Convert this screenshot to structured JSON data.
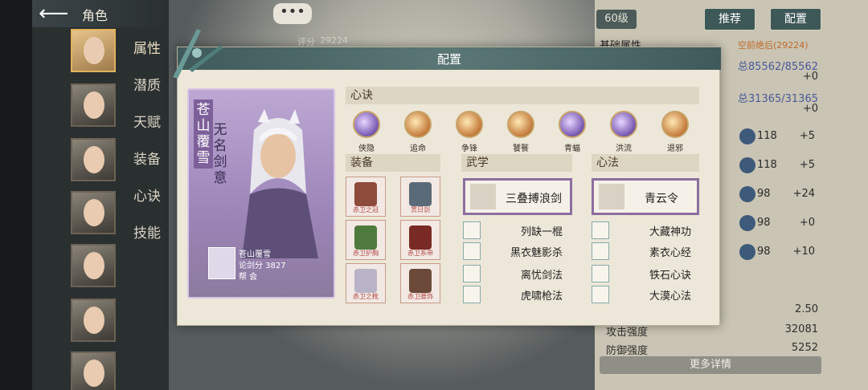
{
  "header": {
    "title": "角色",
    "chat_icon": "•••"
  },
  "nav": [
    "属性",
    "潜质",
    "天赋",
    "装备",
    "心诀",
    "技能"
  ],
  "right_panel": {
    "level": "60级",
    "recommend_label": "推荐",
    "config_label": "配置",
    "score_label": "评分",
    "score_value": "29224",
    "base_attr_label": "基础属性",
    "rank_text": "空前绝后(29224)",
    "hp": "总85562/85562",
    "hp_plus": "+0",
    "mp": "总31365/31365",
    "mp_plus": "+0",
    "side_stats": [
      {
        "v1": "118",
        "v2": "+5"
      },
      {
        "v1": "118",
        "v2": "+5"
      },
      {
        "v1": "98",
        "v2": "+24"
      },
      {
        "v1": "98",
        "v2": "+0"
      },
      {
        "v1": "98",
        "v2": "+10"
      }
    ],
    "value_250": "2.50",
    "attack_label": "攻击强度",
    "attack_value": "32081",
    "defense_label": "防御强度",
    "defense_value": "5252",
    "more_label": "更多详情"
  },
  "modal": {
    "title": "配置",
    "card": {
      "name_vertical": "苍山覆雪",
      "title_vertical": "无名剑意",
      "player_name": "苍山覆雪",
      "score_text": "论剑分 3827",
      "guild_text": "帮  会"
    },
    "xinjue_header": "心诀",
    "skills": [
      "侠隐",
      "追命",
      "争锋",
      "饕餮",
      "青蝠",
      "洪流",
      "退邪"
    ],
    "equip_header": "装备",
    "equipment": [
      "赤卫之冠",
      "贯日剑",
      "赤卫护胸",
      "赤卫系带",
      "赤卫之靴",
      "赤卫腰饰"
    ],
    "wuxue_header": "武学",
    "wuxue_main": "三叠搏浪剑",
    "wuxue_list": [
      "列缺一棍",
      "黑衣魅影杀",
      "离忧剑法",
      "虎啸枪法"
    ],
    "xinfa_header": "心法",
    "xinfa_main": "青云令",
    "xinfa_list": [
      "大藏神功",
      "素衣心经",
      "铁石心诀",
      "大漠心法"
    ]
  }
}
